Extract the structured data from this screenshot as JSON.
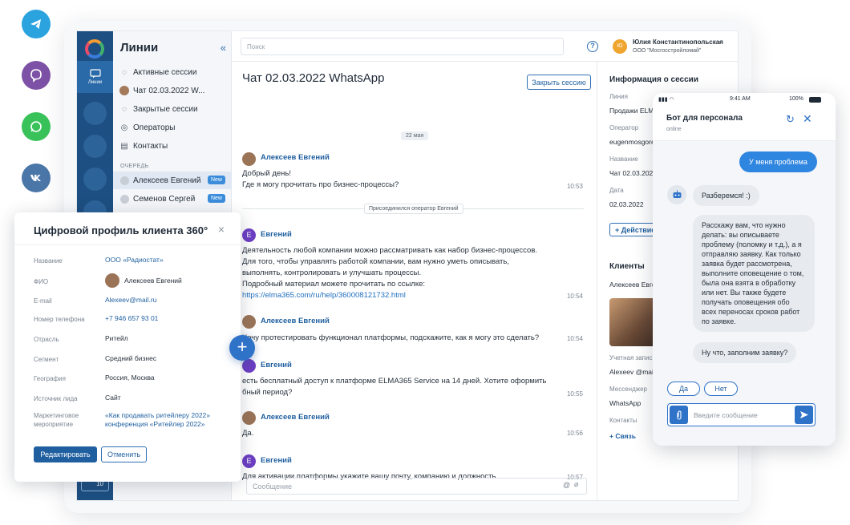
{
  "sidebar": {
    "rail_label": "Линии",
    "title": "Линии",
    "collapse_icon": "«",
    "items": [
      "Активные сессии",
      "Чат 02.03.2022 W...",
      "Закрытые сессии",
      "Операторы",
      "Контакты"
    ],
    "queue_label": "ОЧЕРЕДЬ",
    "queue": [
      {
        "name": "Алексеев Евгений",
        "badge": "New"
      },
      {
        "name": "Семенов Сергей",
        "badge": "New"
      }
    ]
  },
  "topbar": {
    "search_placeholder": "Поиск",
    "help": "?",
    "user_initials": "Ю",
    "user_name": "Юлия Константинопольская",
    "user_org": "ООО \"Мосгосстройломай\""
  },
  "chat": {
    "title": "Чат 02.03.2022 WhatsApp",
    "close_button": "Закрыть сессию",
    "date": "22 мая",
    "system_message": "Присоединился оператор Евгений",
    "messages": [
      {
        "author": "Алексеев Евгений",
        "text": "Добрый день!\nГде я могу прочитать про бизнес-процессы?",
        "time": "10:53"
      },
      {
        "author": "Евгений",
        "text": "Деятельность любой компании можно рассматривать как набор бизнес-процессов. Для того, чтобы управлять работой компании, вам нужно уметь описывать, выполнять, контролировать и улучшать процессы.\nПодробный материал можете прочитать по ссылке:",
        "link": "https://elma365.com/ru/help/360008121732.html",
        "time": "10:54"
      },
      {
        "author": "Алексеев Евгений",
        "text": "Хочу протестировать функционал платформы, подскажите, как я могу это сделать?",
        "time": "10:54"
      },
      {
        "author": "Евгений",
        "text": "есть бесплатный доступ к платформе ELMA365 Service на 14 дней. Хотите оформить бный период?",
        "time": "10:55"
      },
      {
        "author": "Алексеев Евгений",
        "text": "Да.",
        "time": "10:56"
      },
      {
        "author": "Евгений",
        "text": "Для активации платформы укажите вашу почту, компанию и должность.",
        "time": "10:57"
      }
    ],
    "composer_placeholder": "Сообщение"
  },
  "info": {
    "title": "Информация о сессии",
    "fields": [
      {
        "label": "Линия",
        "value": "Продажи ELM"
      },
      {
        "label": "Оператор",
        "value": "eugenmosgore"
      },
      {
        "label": "Название",
        "value": "Чат 02.03.202"
      },
      {
        "label": "Дата",
        "value": "02.03.2022"
      }
    ],
    "action_button": "+ Действие",
    "clients_title": "Клиенты",
    "client_name": "Алексеев Евге",
    "client_fields": [
      {
        "label": "Учетная запис",
        "value": "Alexeev @mail."
      },
      {
        "label": "Мессенджер",
        "value": "WhatsApp"
      },
      {
        "label": "Контакты",
        "value": "+ Связь"
      }
    ]
  },
  "card": {
    "title": "Цифровой профиль клиента 360°",
    "close": "×",
    "rows": [
      {
        "label": "Название",
        "value": "ООО «Радиостат»",
        "link": true
      },
      {
        "label": "ФИО",
        "value": "Алексеев Евгений",
        "link": false
      },
      {
        "label": "E-mail",
        "value": "Alexeev@mail.ru",
        "link": true
      },
      {
        "label": "Номер телефона",
        "value": "+7 946 657 93 01",
        "link": true
      },
      {
        "label": "Отрасль",
        "value": "Ритейл",
        "link": false
      },
      {
        "label": "Сегмент",
        "value": "Средний бизнес",
        "link": false
      },
      {
        "label": "География",
        "value": "Россия, Москва",
        "link": false
      },
      {
        "label": "Источник лида",
        "value": "Сайт",
        "link": false
      },
      {
        "label": "Маркетинговое мероприятие",
        "value": "«Как продавать ритейлеру 2022» конференция «Ритейлер 2022»",
        "link": true
      }
    ],
    "edit_button": "Редактировать",
    "cancel_button": "Отменить"
  },
  "fab": "+",
  "rail_counter": "10",
  "phone": {
    "time": "9:41 AM",
    "battery": "100%",
    "title": "Бот для персонала",
    "status": "online",
    "bubbles": {
      "user1": "У меня проблема",
      "bot1": "Разберемся! :)",
      "bot2": "Расскажу вам, что нужно делать: вы описываете проблему (поломку и т.д.), а я отправляю заявку. Как только заявка будет рассмотрена, выполните оповещение о том, была она взята в обработку или нет. Вы также будете получать оповещения обо всех переносах сроков работ по заявке.",
      "bot3": "Ну что, заполним заявку?"
    },
    "chips": [
      "Да",
      "Нет"
    ],
    "input_placeholder": "Введите сообщение"
  },
  "colors": {
    "brand": "#1d4f82",
    "accent": "#2f73c9",
    "telegram": "#2aa3df",
    "viber": "#7d51a5",
    "whatsapp": "#39c25a",
    "vk": "#4a76a8"
  }
}
